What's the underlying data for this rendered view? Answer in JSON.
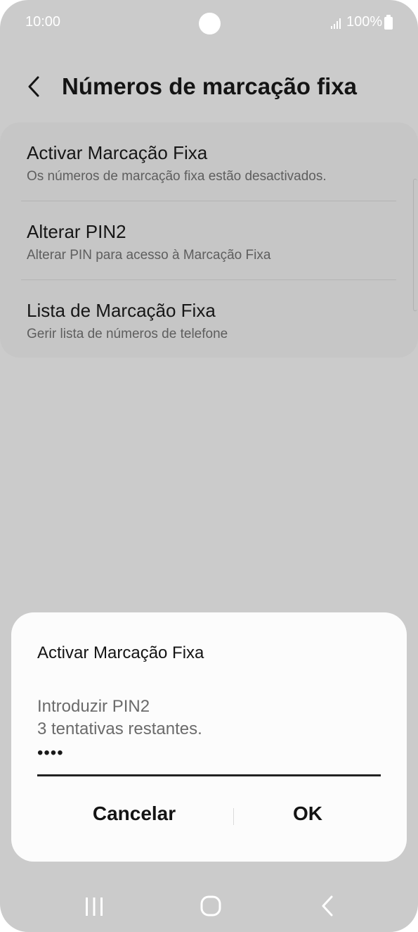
{
  "status_bar": {
    "time": "10:00",
    "battery": "100%",
    "icons": [
      "signal-icon",
      "battery-icon"
    ]
  },
  "header": {
    "back_icon": "chevron-left-icon",
    "title": "Números de marcação fixa"
  },
  "settings_items": [
    {
      "title": "Activar Marcação Fixa",
      "subtitle": "Os números de marcação fixa estão desactivados."
    },
    {
      "title": "Alterar PIN2",
      "subtitle": "Alterar PIN para acesso à Marcação Fixa"
    },
    {
      "title": "Lista de Marcação Fixa",
      "subtitle": "Gerir lista de números de telefone"
    }
  ],
  "dialog": {
    "title": "Activar Marcação Fixa",
    "prompt_line1": "Introduzir PIN2",
    "prompt_line2": "3 tentativas restantes.",
    "pin_value": "••••",
    "cancel_label": "Cancelar",
    "ok_label": "OK"
  },
  "nav_bar": {
    "icons": [
      "recents-icon",
      "home-icon",
      "back-icon"
    ]
  },
  "colors": {
    "dimmed_background": "#cbcbcb",
    "dialog_background": "#fcfcfc",
    "text_primary": "#141414"
  }
}
